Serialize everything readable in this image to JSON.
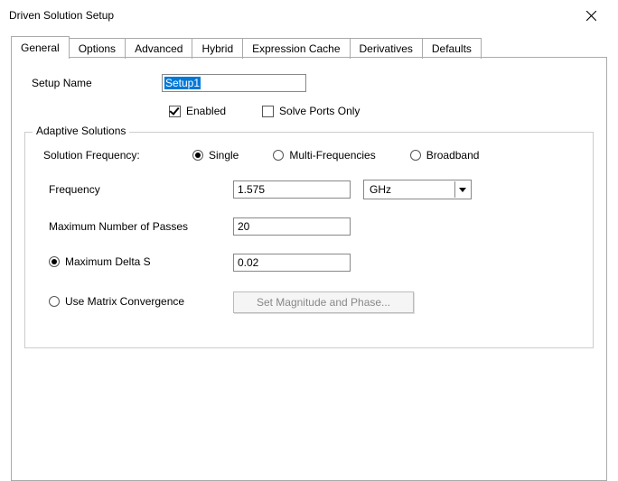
{
  "window": {
    "title": "Driven Solution Setup"
  },
  "tabs": {
    "general": "General",
    "options": "Options",
    "advanced": "Advanced",
    "hybrid": "Hybrid",
    "expression_cache": "Expression Cache",
    "derivatives": "Derivatives",
    "defaults": "Defaults"
  },
  "form": {
    "setup_name_label": "Setup Name",
    "setup_name_value": "Setup1",
    "enabled_label": "Enabled",
    "solve_ports_label": "Solve Ports Only"
  },
  "group": {
    "title": "Adaptive Solutions",
    "solution_freq_label": "Solution Frequency:",
    "radio_single": "Single",
    "radio_multi": "Multi-Frequencies",
    "radio_broadband": "Broadband",
    "frequency_label": "Frequency",
    "frequency_value": "1.575",
    "frequency_unit": "GHz",
    "max_passes_label": "Maximum Number of Passes",
    "max_passes_value": "20",
    "max_delta_label": "Maximum Delta S",
    "max_delta_value": "0.02",
    "matrix_conv_label": "Use Matrix Convergence",
    "set_mag_phase_btn": "Set Magnitude and Phase..."
  }
}
